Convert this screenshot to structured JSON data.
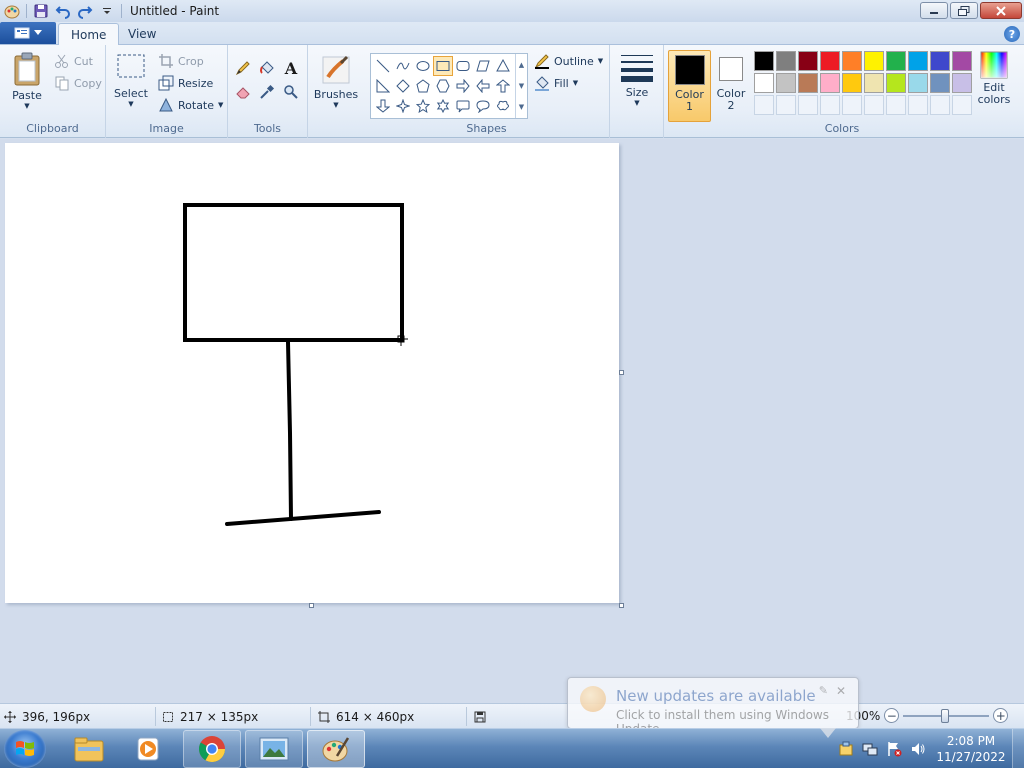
{
  "window": {
    "title": "Untitled - Paint"
  },
  "tabs": {
    "home": "Home",
    "view": "View"
  },
  "ribbon": {
    "clipboard": {
      "label": "Clipboard",
      "paste": "Paste",
      "cut": "Cut",
      "copy": "Copy"
    },
    "image": {
      "label": "Image",
      "select": "Select",
      "crop": "Crop",
      "resize": "Resize",
      "rotate": "Rotate"
    },
    "tools": {
      "label": "Tools",
      "items": [
        "pencil-icon",
        "fill-bucket-icon",
        "text-icon",
        "eraser-icon",
        "color-picker-icon",
        "magnifier-icon"
      ],
      "text_glyph": "A"
    },
    "brushes": {
      "label": "Brushes"
    },
    "shapes": {
      "label": "Shapes",
      "selected": "rectangle",
      "outline": "Outline",
      "fill": "Fill"
    },
    "size": {
      "label": "Size"
    },
    "colors": {
      "label": "Colors",
      "color1_line1": "Color",
      "color1_line2": "1",
      "color2_line1": "Color",
      "color2_line2": "2",
      "color1_value": "#000000",
      "color2_value": "#ffffff",
      "edit_line1": "Edit",
      "edit_line2": "colors",
      "palette_row1": [
        "#000000",
        "#7f7f7f",
        "#880015",
        "#ed1c24",
        "#ff7f27",
        "#fff200",
        "#22b14c",
        "#00a2e8",
        "#3f48cc",
        "#a349a4"
      ],
      "palette_row2": [
        "#ffffff",
        "#c3c3c3",
        "#b97a57",
        "#ffaec9",
        "#ffc90e",
        "#efe4b0",
        "#b5e61d",
        "#99d9ea",
        "#7092be",
        "#c8bfe7"
      ]
    }
  },
  "status": {
    "cursor_pos": "396, 196px",
    "selection_size": "217 × 135px",
    "canvas_size": "614 × 460px",
    "zoom": "100%"
  },
  "notification": {
    "title": "New updates are available",
    "text": "Click to install them using Windows Update"
  },
  "taskbar": {
    "apps": [
      "explorer-icon",
      "media-player-icon",
      "chrome-icon",
      "photo-viewer-icon",
      "paint-icon"
    ],
    "time": "2:08 PM",
    "date": "11/27/2022"
  }
}
